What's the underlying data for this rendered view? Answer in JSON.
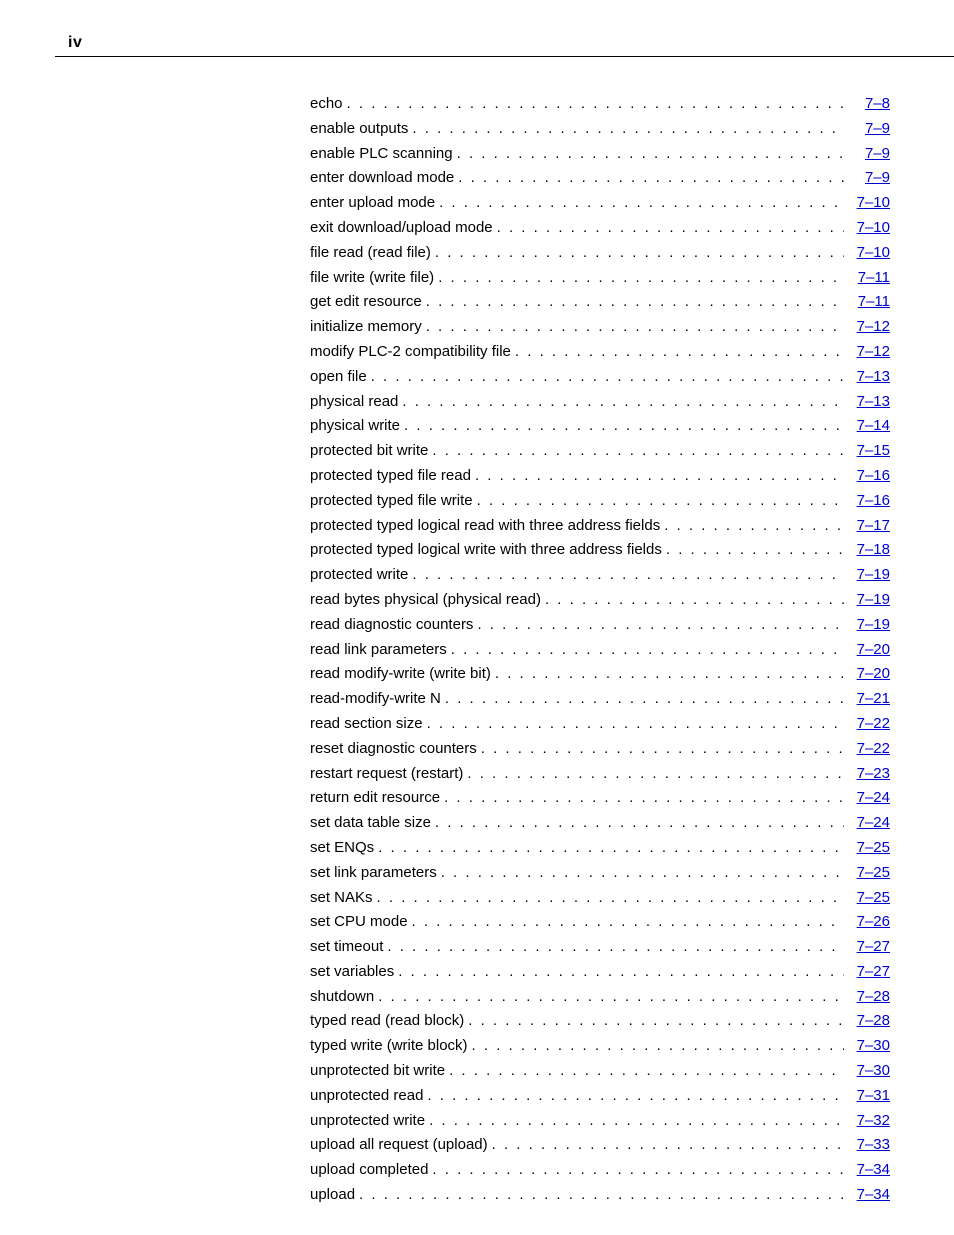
{
  "page_number": "iv",
  "toc": [
    {
      "label": "echo",
      "page": "7–8"
    },
    {
      "label": "enable outputs",
      "page": "7–9"
    },
    {
      "label": "enable PLC scanning",
      "page": "7–9"
    },
    {
      "label": "enter download mode",
      "page": "7–9"
    },
    {
      "label": "enter upload mode",
      "page": "7–10"
    },
    {
      "label": "exit download/upload mode",
      "page": "7–10"
    },
    {
      "label": "file read (read file)",
      "page": "7–10"
    },
    {
      "label": "file write (write file)",
      "page": "7–11"
    },
    {
      "label": "get edit resource",
      "page": "7–11"
    },
    {
      "label": "initialize memory",
      "page": "7–12"
    },
    {
      "label": "modify PLC-2 compatibility file",
      "page": "7–12"
    },
    {
      "label": "open file",
      "page": "7–13"
    },
    {
      "label": "physical read",
      "page": "7–13"
    },
    {
      "label": "physical write",
      "page": "7–14"
    },
    {
      "label": "protected bit write",
      "page": "7–15"
    },
    {
      "label": "protected typed file read",
      "page": "7–16"
    },
    {
      "label": "protected typed file write",
      "page": "7–16"
    },
    {
      "label": "protected typed logical read with three address fields",
      "page": "7–17"
    },
    {
      "label": "protected typed logical write with three address fields",
      "page": "7–18"
    },
    {
      "label": "protected write",
      "page": "7–19"
    },
    {
      "label": "read bytes physical (physical read)",
      "page": "7–19"
    },
    {
      "label": "read diagnostic counters",
      "page": "7–19"
    },
    {
      "label": "read link parameters",
      "page": "7–20"
    },
    {
      "label": "read modify-write (write bit)",
      "page": "7–20"
    },
    {
      "label": "read-modify-write N",
      "page": "7–21"
    },
    {
      "label": "read section size",
      "page": "7–22"
    },
    {
      "label": "reset diagnostic counters",
      "page": "7–22"
    },
    {
      "label": "restart request (restart)",
      "page": "7–23"
    },
    {
      "label": "return edit resource",
      "page": "7–24"
    },
    {
      "label": "set data table size",
      "page": "7–24"
    },
    {
      "label": "set ENQs",
      "page": "7–25"
    },
    {
      "label": "set link parameters",
      "page": "7–25"
    },
    {
      "label": "set NAKs",
      "page": "7–25"
    },
    {
      "label": "set CPU mode",
      "page": "7–26"
    },
    {
      "label": "set timeout",
      "page": "7–27"
    },
    {
      "label": "set variables",
      "page": "7–27"
    },
    {
      "label": "shutdown",
      "page": "7–28"
    },
    {
      "label": "typed read (read block)",
      "page": "7–28"
    },
    {
      "label": "typed write (write block)",
      "page": "7–30"
    },
    {
      "label": "unprotected bit write",
      "page": "7–30"
    },
    {
      "label": "unprotected read",
      "page": "7–31"
    },
    {
      "label": "unprotected write",
      "page": "7–32"
    },
    {
      "label": "upload all request (upload)",
      "page": "7–33"
    },
    {
      "label": "upload completed",
      "page": "7–34"
    },
    {
      "label": "upload",
      "page": "7–34"
    }
  ]
}
